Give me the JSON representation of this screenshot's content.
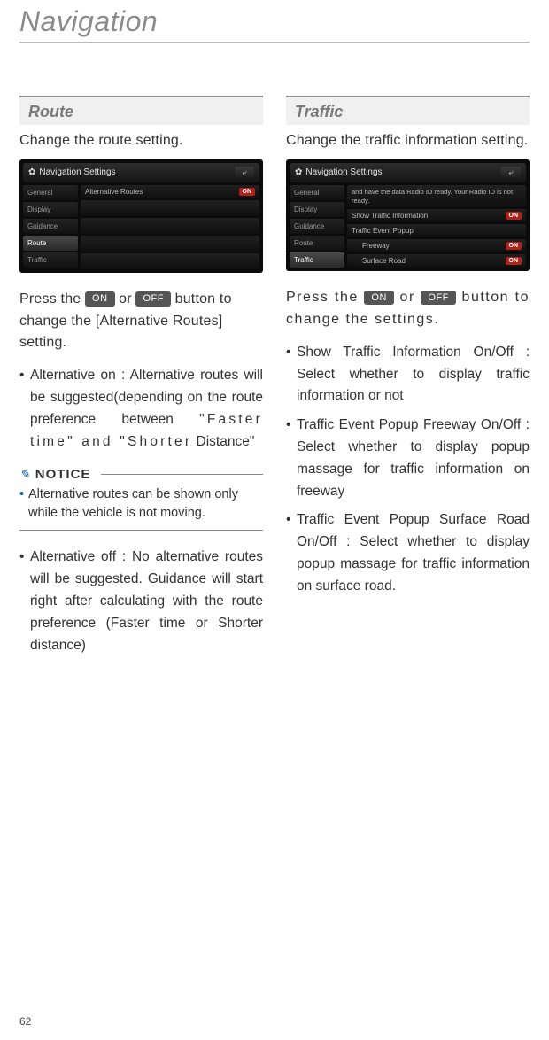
{
  "page": {
    "title": "Navigation",
    "number": "62"
  },
  "buttons": {
    "on": "ON",
    "off": "OFF"
  },
  "left": {
    "heading": "Route",
    "intro": "Change the route setting.",
    "screenshot": {
      "title": "Navigation Settings",
      "tabs": [
        "General",
        "Display",
        "Guidance",
        "Route",
        "Traffic"
      ],
      "selected": 3,
      "rows": [
        {
          "label": "Alternative Routes",
          "toggle": "ON"
        }
      ]
    },
    "press1": "Press the ",
    "press2": " or ",
    "press3": " button to change the [Alternative Routes] setting.",
    "bullet1_a": "Alternative on : Alternative routes will be suggested(depending on the route preference between ",
    "bullet1_b": "\"Faster time\" and \"Shorter",
    "bullet1_c": " Distance\"",
    "notice_label": "NOTICE",
    "notice_body": "Alternative routes can be shown only while the vehicle is not moving.",
    "bullet2": "Alternative off : No alternative routes will be suggested. Guidance will start right after calculating with the route preference (Faster time or Shorter distance)"
  },
  "right": {
    "heading": "Traffic",
    "intro": "Change the traffic information setting.",
    "screenshot": {
      "title": "Navigation Settings",
      "tabs": [
        "General",
        "Display",
        "Guidance",
        "Route",
        "Traffic"
      ],
      "selected": 4,
      "text_lines": "and have the data Radio ID ready. Your Radio ID is not ready.",
      "rows": [
        {
          "label": "Show Traffic Information",
          "toggle": "ON"
        },
        {
          "label": "Traffic Event Popup",
          "toggle": null
        },
        {
          "label": "Freeway",
          "toggle": "ON",
          "indent": true
        },
        {
          "label": "Surface Road",
          "toggle": "ON",
          "indent": true
        }
      ]
    },
    "press1": "Press the ",
    "press2": " or ",
    "press3": " button to change the settings.",
    "bullet1": "Show Traffic Information On/Off : Select whether to display traffic information or not",
    "bullet2": "Traffic Event Popup Freeway On/Off : Select whether to display popup massage for traffic information on freeway",
    "bullet3": "Traffic Event Popup Surface Road On/Off : Select whether to display popup massage for traffic information on surface road."
  }
}
